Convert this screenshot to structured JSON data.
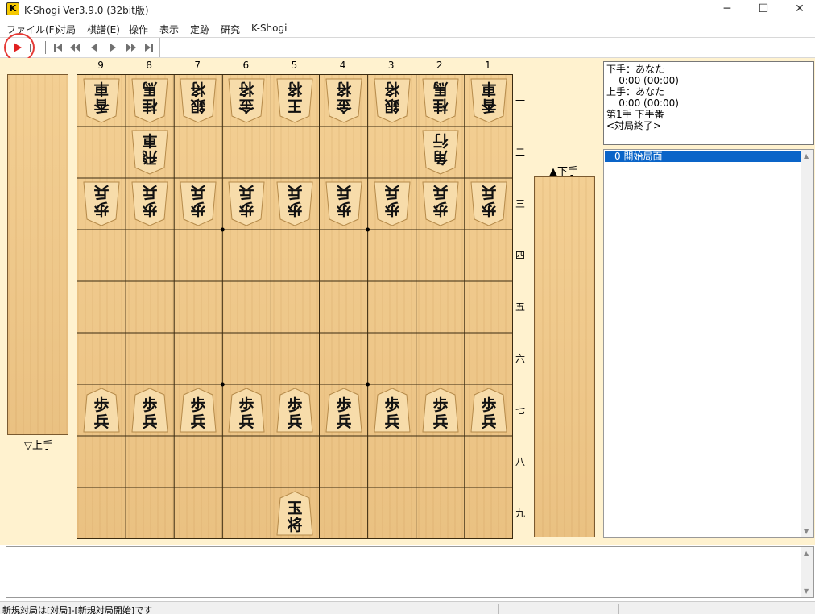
{
  "window": {
    "app_icon": "K",
    "title": "K-Shogi Ver3.9.0 (32bit版)",
    "minimize_glyph": "─",
    "maximize_glyph": "☐",
    "close_glyph": "✕"
  },
  "menu": [
    "ファイル(F)",
    "対局",
    "棋譜(E)",
    "操作",
    "表示",
    "定跡",
    "研究",
    "K-Shogi"
  ],
  "toolbar": {
    "icons": [
      "play-icon",
      "stop-icon",
      "first-move-icon",
      "back-many-icon",
      "back-one-icon",
      "forward-one-icon",
      "forward-many-icon",
      "last-move-icon"
    ],
    "colors": {
      "play": "#e02020",
      "nav": "#707070",
      "highlight_circle": "#e53935"
    }
  },
  "board": {
    "file_labels": [
      "9",
      "8",
      "7",
      "6",
      "5",
      "4",
      "3",
      "2",
      "1"
    ],
    "rank_labels": [
      "一",
      "二",
      "三",
      "四",
      "五",
      "六",
      "七",
      "八",
      "九"
    ],
    "pieces": [
      {
        "file": 9,
        "rank": 1,
        "top": "香",
        "bottom": "車",
        "owner": "gote"
      },
      {
        "file": 8,
        "rank": 1,
        "top": "桂",
        "bottom": "馬",
        "owner": "gote"
      },
      {
        "file": 7,
        "rank": 1,
        "top": "銀",
        "bottom": "将",
        "owner": "gote"
      },
      {
        "file": 6,
        "rank": 1,
        "top": "金",
        "bottom": "将",
        "owner": "gote"
      },
      {
        "file": 5,
        "rank": 1,
        "top": "王",
        "bottom": "将",
        "owner": "gote"
      },
      {
        "file": 4,
        "rank": 1,
        "top": "金",
        "bottom": "将",
        "owner": "gote"
      },
      {
        "file": 3,
        "rank": 1,
        "top": "銀",
        "bottom": "将",
        "owner": "gote"
      },
      {
        "file": 2,
        "rank": 1,
        "top": "桂",
        "bottom": "馬",
        "owner": "gote"
      },
      {
        "file": 1,
        "rank": 1,
        "top": "香",
        "bottom": "車",
        "owner": "gote"
      },
      {
        "file": 8,
        "rank": 2,
        "top": "飛",
        "bottom": "車",
        "owner": "gote"
      },
      {
        "file": 2,
        "rank": 2,
        "top": "角",
        "bottom": "行",
        "owner": "gote"
      },
      {
        "file": 9,
        "rank": 3,
        "top": "歩",
        "bottom": "兵",
        "owner": "gote"
      },
      {
        "file": 8,
        "rank": 3,
        "top": "歩",
        "bottom": "兵",
        "owner": "gote"
      },
      {
        "file": 7,
        "rank": 3,
        "top": "歩",
        "bottom": "兵",
        "owner": "gote"
      },
      {
        "file": 6,
        "rank": 3,
        "top": "歩",
        "bottom": "兵",
        "owner": "gote"
      },
      {
        "file": 5,
        "rank": 3,
        "top": "歩",
        "bottom": "兵",
        "owner": "gote"
      },
      {
        "file": 4,
        "rank": 3,
        "top": "歩",
        "bottom": "兵",
        "owner": "gote"
      },
      {
        "file": 3,
        "rank": 3,
        "top": "歩",
        "bottom": "兵",
        "owner": "gote"
      },
      {
        "file": 2,
        "rank": 3,
        "top": "歩",
        "bottom": "兵",
        "owner": "gote"
      },
      {
        "file": 1,
        "rank": 3,
        "top": "歩",
        "bottom": "兵",
        "owner": "gote"
      },
      {
        "file": 9,
        "rank": 7,
        "top": "歩",
        "bottom": "兵",
        "owner": "sente"
      },
      {
        "file": 8,
        "rank": 7,
        "top": "歩",
        "bottom": "兵",
        "owner": "sente"
      },
      {
        "file": 7,
        "rank": 7,
        "top": "歩",
        "bottom": "兵",
        "owner": "sente"
      },
      {
        "file": 6,
        "rank": 7,
        "top": "歩",
        "bottom": "兵",
        "owner": "sente"
      },
      {
        "file": 5,
        "rank": 7,
        "top": "歩",
        "bottom": "兵",
        "owner": "sente"
      },
      {
        "file": 4,
        "rank": 7,
        "top": "歩",
        "bottom": "兵",
        "owner": "sente"
      },
      {
        "file": 3,
        "rank": 7,
        "top": "歩",
        "bottom": "兵",
        "owner": "sente"
      },
      {
        "file": 2,
        "rank": 7,
        "top": "歩",
        "bottom": "兵",
        "owner": "sente"
      },
      {
        "file": 1,
        "rank": 7,
        "top": "歩",
        "bottom": "兵",
        "owner": "sente"
      },
      {
        "file": 5,
        "rank": 9,
        "top": "玉",
        "bottom": "将",
        "owner": "sente"
      }
    ]
  },
  "hands": {
    "gote_label": "▽上手",
    "sente_label": "▲下手"
  },
  "info": {
    "line1": "下手：あなた",
    "line2": "    0:00 (00:00)",
    "line3": "上手：あなた",
    "line4": "    0:00 (00:00)",
    "line5": "第1手 下手番",
    "line6": "<対局終了>"
  },
  "move_list": {
    "items": [
      "  0 開始局面"
    ],
    "selected_index": 0
  },
  "status_bar": {
    "text": "新規対局は[対局]-[新規対局開始]です"
  }
}
